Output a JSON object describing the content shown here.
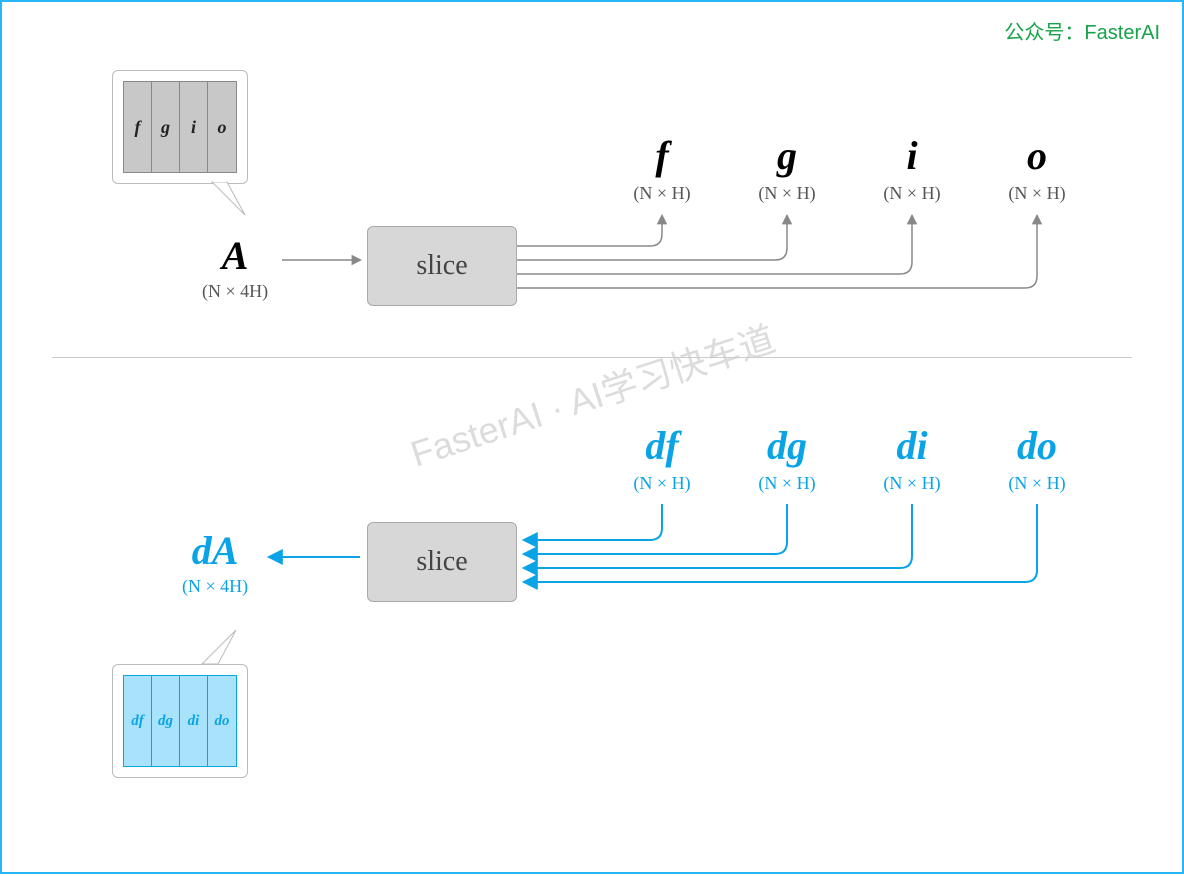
{
  "attribution": "公众号：FasterAI",
  "watermark": "FasterAI · AI学习快车道",
  "forward": {
    "input_var": "A",
    "input_dim": "(N × 4H)",
    "op": "slice",
    "matrix_cols": [
      "f",
      "g",
      "i",
      "o"
    ],
    "outputs": [
      {
        "sym": "f",
        "dim": "(N × H)"
      },
      {
        "sym": "g",
        "dim": "(N × H)"
      },
      {
        "sym": "i",
        "dim": "(N × H)"
      },
      {
        "sym": "o",
        "dim": "(N × H)"
      }
    ]
  },
  "backward": {
    "output_var": "dA",
    "output_dim": "(N × 4H)",
    "op": "slice",
    "matrix_cols": [
      "df",
      "dg",
      "di",
      "do"
    ],
    "inputs": [
      {
        "sym": "df",
        "dim": "(N × H)"
      },
      {
        "sym": "dg",
        "dim": "(N × H)"
      },
      {
        "sym": "di",
        "dim": "(N × H)"
      },
      {
        "sym": "do",
        "dim": "(N × H)"
      }
    ]
  }
}
